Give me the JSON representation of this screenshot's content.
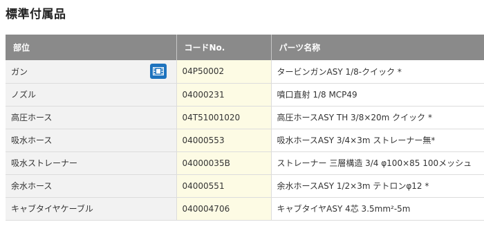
{
  "page": {
    "title": "標準付属品"
  },
  "table": {
    "headers": [
      "部位",
      "コードNo.",
      "パーツ名称"
    ],
    "rows": [
      {
        "part": "ガン",
        "code": "04P50002",
        "name": "タービンガンASY 1/8-クイック *",
        "has_video": true
      },
      {
        "part": "ノズル",
        "code": "04000231",
        "name": "噴口直射 1/8 MCP49"
      },
      {
        "part": "高圧ホース",
        "code": "04T51001020",
        "name": "高圧ホースASY TH 3/8×20m クイック *"
      },
      {
        "part": "吸水ホース",
        "code": "04000553",
        "name": "吸水ホースASY 3/4×3m ストレーナー無*"
      },
      {
        "part": "吸水ストレーナー",
        "code": "04000035B",
        "name": "ストレーナー 三層構造 3/4 φ100×85 100メッシュ"
      },
      {
        "part": "余水ホース",
        "code": "04000551",
        "name": "余水ホースASY 1/2×3m テトロンφ12 *"
      },
      {
        "part": "キャブタイヤケーブル",
        "code": "040004706",
        "name": "キャブタイヤASY 4芯 3.5mm²-5m"
      }
    ]
  },
  "icons": {
    "video": "video-film-icon"
  },
  "colors": {
    "header_bg": "#8a8a8a",
    "category_bg": "#f2f2f2",
    "code_bg": "#fdfbe4",
    "video_button": "#1e73be"
  }
}
